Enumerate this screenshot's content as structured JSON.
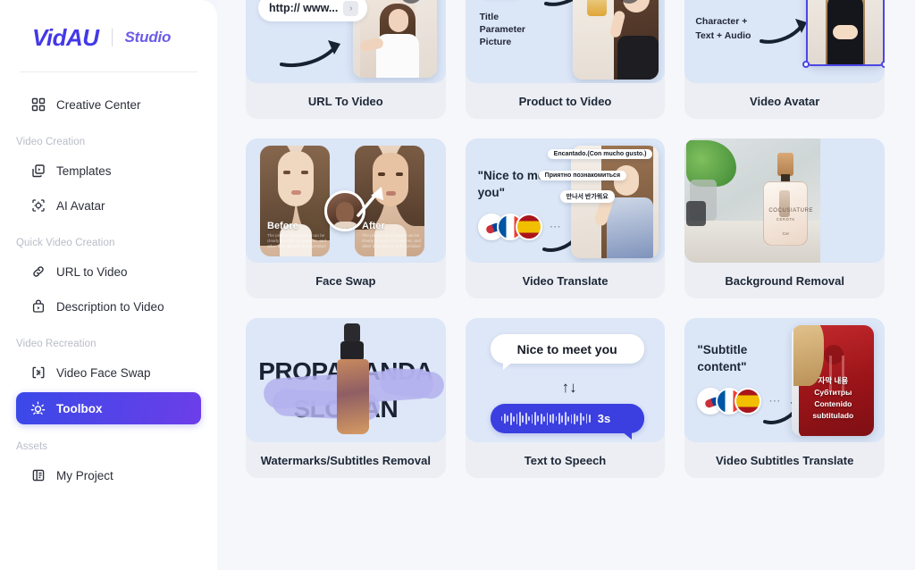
{
  "sidebar": {
    "logo": {
      "main": "VidAU",
      "sub": "Studio"
    },
    "items": [
      {
        "label": "Creative Center",
        "icon": "grid-icon",
        "type": "item",
        "active": false
      },
      {
        "label": "Video Creation",
        "type": "group"
      },
      {
        "label": "Templates",
        "icon": "templates-icon",
        "type": "item",
        "active": false
      },
      {
        "label": "AI Avatar",
        "icon": "avatar-icon",
        "type": "item",
        "active": false
      },
      {
        "label": "Quick Video Creation",
        "type": "group"
      },
      {
        "label": "URL to Video",
        "icon": "link-icon",
        "type": "item",
        "active": false
      },
      {
        "label": "Description to Video",
        "icon": "description-icon",
        "type": "item",
        "active": false
      },
      {
        "label": "Video Recreation",
        "type": "group"
      },
      {
        "label": "Video Face Swap",
        "icon": "face-swap-icon",
        "type": "item",
        "active": false
      },
      {
        "label": "Toolbox",
        "icon": "lightbulb-icon",
        "type": "item",
        "active": true
      },
      {
        "label": "Assets",
        "type": "group"
      },
      {
        "label": "My Project",
        "icon": "project-icon",
        "type": "item",
        "active": false
      }
    ]
  },
  "colors": {
    "accent_start": "#3a49e8",
    "accent_end": "#6c3ee8",
    "logo": "#4338e8",
    "logo_sub": "#6b5ce7",
    "card_bg": "#eceef4",
    "card_media_bg": "#dbe6f7",
    "page_bg": "#f6f7fb",
    "label_text": "#1d2736",
    "tts_blue": "#3b3fe0",
    "brush_lavender": "#b3b0ee"
  },
  "cards": [
    {
      "id": "url-to-video",
      "label": "URL To Video",
      "url_pill": "http:// www...",
      "go_glyph": "›"
    },
    {
      "id": "product-to-video",
      "label": "Product to Video",
      "caption_lines": [
        "Title",
        "Parameter",
        "Picture"
      ],
      "dots": "⋯"
    },
    {
      "id": "video-avatar",
      "label": "Video Avatar",
      "caption_lines": [
        "Character +",
        "Text + Audio"
      ],
      "dots": "⋯"
    },
    {
      "id": "face-swap",
      "label": "Face Swap",
      "before_caption": "Before",
      "after_caption": "After",
      "blurb": "The product description, can be clearly through the features, and other descriptions of the product"
    },
    {
      "id": "video-translate",
      "label": "Video Translate",
      "quote": "\"Nice to meet you\"",
      "flags": [
        "kr",
        "fr",
        "es"
      ],
      "dots": "⋯",
      "subtitles": [
        "Encantado.(Con mucho gusto.)",
        "Приятно познакомиться",
        "만나서 반가워요"
      ]
    },
    {
      "id": "background-removal",
      "label": "Background Removal",
      "bottle_brand": "COCUSIATURE",
      "bottle_sub": "CERDTK",
      "bottle_small": "Cer"
    },
    {
      "id": "watermarks-subtitles-removal",
      "label": "Watermarks/Subtitles Removal",
      "overlay_line1": "PROPAGANDA",
      "overlay_line2": "SLOGAN"
    },
    {
      "id": "text-to-speech",
      "label": "Text to Speech",
      "bubble_text": "Nice to meet you",
      "arrows": "↑↓",
      "duration": "3s"
    },
    {
      "id": "video-subtitles-translate",
      "label": "Video Subtitles Translate",
      "quote": "\"Subtitle content\"",
      "flags": [
        "kr",
        "fr",
        "es"
      ],
      "dots": "⋯",
      "subtitle_lines": [
        "자막 내용",
        "Субтитры",
        "Contenido",
        "subtitulado"
      ]
    }
  ]
}
